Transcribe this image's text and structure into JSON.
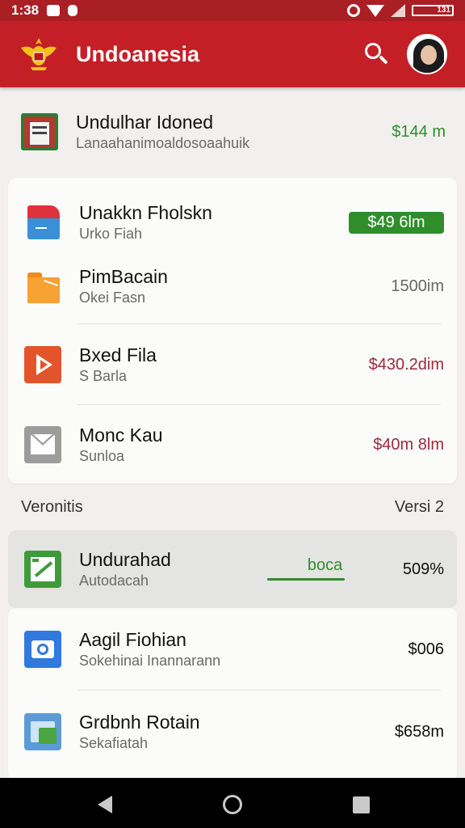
{
  "status_bar": {
    "time": "1:38",
    "battery": "131"
  },
  "app_bar": {
    "title": "Undoanesia"
  },
  "top_item": {
    "title": "Undulhar Idoned",
    "subtitle": "Lanaahanimoaldosoaahuik",
    "value": "$144 m"
  },
  "list_card": [
    {
      "title": "Unakkn Fholskn",
      "subtitle": "Urko Fiah",
      "value": "$49 6lm",
      "value_style": "badge"
    },
    {
      "title": "PimBacain",
      "subtitle": "Okei Fasn",
      "value": "1500im",
      "value_style": "gray"
    },
    {
      "title": "Bxed Fila",
      "subtitle": "S Barla",
      "value": "$430.2dim",
      "value_style": "maroon"
    },
    {
      "title": "Monc Kau",
      "subtitle": "Sunloa",
      "value": "$40m 8lm",
      "value_style": "maroon"
    }
  ],
  "section": {
    "label": "Veronitis",
    "right": "Versi 2"
  },
  "highlight_item": {
    "title": "Undurahad",
    "subtitle": "Autodacah",
    "progress_label": "boca",
    "progress": 0.5,
    "value": "509%"
  },
  "bottom_card": [
    {
      "title": "Aagil Fiohian",
      "subtitle": "Sokehinai Inannarann",
      "value": "$006"
    },
    {
      "title": "Grdbnh Rotain",
      "subtitle": "Sekafiatah",
      "value": "$658m"
    }
  ],
  "colors": {
    "brand_red": "#c41f26",
    "green": "#2f8d2a",
    "maroon": "#9c2a3c"
  }
}
